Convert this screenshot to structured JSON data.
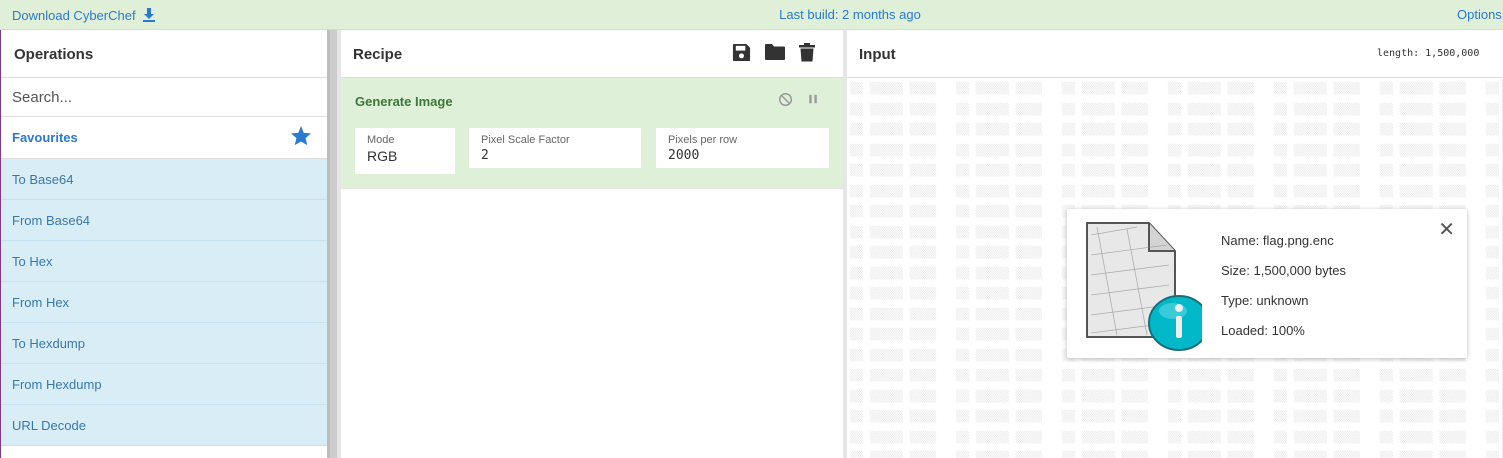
{
  "banner": {
    "download_label": "Download CyberChef",
    "last_build": "Last build: 2 months ago",
    "options_label": "Options"
  },
  "operations": {
    "title": "Operations",
    "search_placeholder": "Search...",
    "favourites_label": "Favourites",
    "items": [
      {
        "label": "To Base64"
      },
      {
        "label": "From Base64"
      },
      {
        "label": "To Hex"
      },
      {
        "label": "From Hex"
      },
      {
        "label": "To Hexdump"
      },
      {
        "label": "From Hexdump"
      },
      {
        "label": "URL Decode"
      }
    ]
  },
  "recipe": {
    "title": "Recipe",
    "tools": [
      "save-icon",
      "folder-icon",
      "trash-icon"
    ],
    "operation": {
      "name": "Generate Image",
      "args": [
        {
          "label": "Mode",
          "value": "RGB"
        },
        {
          "label": "Pixel Scale Factor",
          "value": "2"
        },
        {
          "label": "Pixels per row",
          "value": "2000"
        }
      ]
    }
  },
  "input": {
    "title": "Input",
    "length": "length: 1,500,000",
    "file": {
      "name": "Name: flag.png.enc",
      "size": "Size: 1,500,000 bytes",
      "type": "Type: unknown",
      "loaded": "Loaded: 100%"
    }
  },
  "colors": {
    "banner_bg": "#dfefd8",
    "link": "#2a7ad1",
    "op_bg": "#d9edf7",
    "recipe_op_bg": "#dff0d8",
    "recipe_op_title": "#3c763d"
  }
}
